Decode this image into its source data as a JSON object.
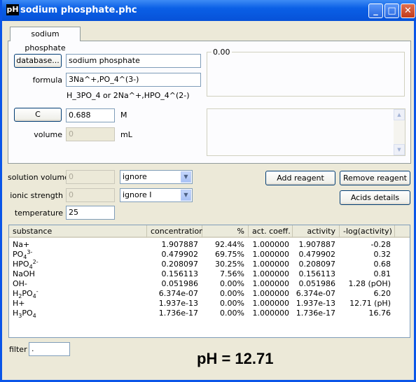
{
  "window": {
    "app_icon": "pH",
    "title": "sodium phosphate.phc",
    "minimize": "_",
    "maximize": "□",
    "close": "✕"
  },
  "tab": {
    "label": "sodium phosphate"
  },
  "reagent": {
    "database_button": "database...",
    "name_value": "sodium phosphate",
    "formula_label": "formula",
    "formula_value": "3Na^+,PO_4^(3-)",
    "formula_hint": "H_3PO_4 or 2Na^+,HPO_4^(2-)",
    "c_button": "C",
    "c_value": "0.688",
    "c_unit": "M",
    "volume_label": "volume",
    "volume_value": "0",
    "volume_unit": "mL",
    "group_value": "0.00"
  },
  "settings": {
    "solution_volume_label": "solution volume",
    "solution_volume_value": "0",
    "solution_volume_option": "ignore",
    "ionic_strength_label": "ionic strength",
    "ionic_strength_value": "0",
    "ionic_strength_option": "ignore I",
    "temperature_label": "temperature",
    "temperature_value": "25"
  },
  "buttons": {
    "add_reagent": "Add reagent",
    "remove_reagent": "Remove reagent",
    "acids_details": "Acids details"
  },
  "table": {
    "columns": [
      "substance",
      "concentration",
      "%",
      "act. coeff.",
      "activity",
      "-log(activity)"
    ],
    "rows": [
      {
        "substance": "Na+",
        "concentration": "1.907887",
        "percent": "92.44%",
        "act_coeff": "1.000000",
        "activity": "1.907887",
        "log_activity": "-0.28"
      },
      {
        "substance": "PO4 3-",
        "concentration": "0.479902",
        "percent": "69.75%",
        "act_coeff": "1.000000",
        "activity": "0.479902",
        "log_activity": "0.32"
      },
      {
        "substance": "HPO4 2-",
        "concentration": "0.208097",
        "percent": "30.25%",
        "act_coeff": "1.000000",
        "activity": "0.208097",
        "log_activity": "0.68"
      },
      {
        "substance": "NaOH",
        "concentration": "0.156113",
        "percent": "7.56%",
        "act_coeff": "1.000000",
        "activity": "0.156113",
        "log_activity": "0.81"
      },
      {
        "substance": "OH-",
        "concentration": "0.051986",
        "percent": "0.00%",
        "act_coeff": "1.000000",
        "activity": "0.051986",
        "log_activity": "1.28 (pOH)"
      },
      {
        "substance": "H2PO4 -",
        "concentration": "6.374e-07",
        "percent": "0.00%",
        "act_coeff": "1.000000",
        "activity": "6.374e-07",
        "log_activity": "6.20"
      },
      {
        "substance": "H+",
        "concentration": "1.937e-13",
        "percent": "0.00%",
        "act_coeff": "1.000000",
        "activity": "1.937e-13",
        "log_activity": "12.71 (pH)"
      },
      {
        "substance": "H3PO4",
        "concentration": "1.736e-17",
        "percent": "0.00%",
        "act_coeff": "1.000000",
        "activity": "1.736e-17",
        "log_activity": "16.76"
      }
    ]
  },
  "substance_display": {
    "na": "Na+",
    "po4_base": "PO",
    "po4_sub": "4",
    "po4_sup": "3-",
    "hpo4_base": "HPO",
    "hpo4_sub": "4",
    "hpo4_sup": "2-",
    "naoh": "NaOH",
    "oh": "OH-",
    "h2po4_a": "H",
    "h2po4_s1": "2",
    "h2po4_b": "PO",
    "h2po4_s2": "4",
    "h2po4_sup": "-",
    "h": "H+",
    "h3po4_a": "H",
    "h3po4_s1": "3",
    "h3po4_b": "PO",
    "h3po4_s2": "4"
  },
  "filter": {
    "label": "filter",
    "value": "."
  },
  "result": {
    "ph_text": "pH = 12.71"
  }
}
